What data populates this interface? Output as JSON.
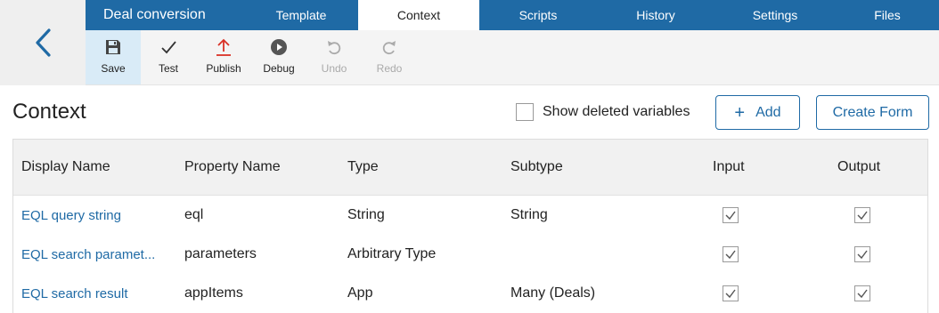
{
  "app": {
    "title": "Deal conversion"
  },
  "tabs": [
    {
      "label": "Template"
    },
    {
      "label": "Context",
      "active": true
    },
    {
      "label": "Scripts"
    },
    {
      "label": "History"
    },
    {
      "label": "Settings"
    },
    {
      "label": "Files"
    }
  ],
  "toolbar": {
    "save": "Save",
    "test": "Test",
    "publish": "Publish",
    "debug": "Debug",
    "undo": "Undo",
    "redo": "Redo"
  },
  "page": {
    "title": "Context",
    "show_deleted_label": "Show deleted variables",
    "show_deleted_checked": false,
    "add_label": "Add",
    "create_form_label": "Create Form"
  },
  "table": {
    "headers": [
      "Display Name",
      "Property Name",
      "Type",
      "Subtype",
      "Input",
      "Output"
    ],
    "rows": [
      {
        "display": "EQL query string",
        "property": "eql",
        "type": "String",
        "subtype": "String",
        "input": true,
        "output": true
      },
      {
        "display": "EQL search paramet...",
        "property": "parameters",
        "type": "Arbitrary Type",
        "subtype": "",
        "input": true,
        "output": true
      },
      {
        "display": "EQL search result",
        "property": "appItems",
        "type": "App",
        "subtype": "Many (Deals)",
        "input": true,
        "output": true
      }
    ]
  },
  "colors": {
    "brand": "#1f6aa5",
    "publish": "#d93025",
    "toolbar_active": "#d9ebf7"
  },
  "icons": {
    "back": "chevron-left-icon",
    "save": "floppy-icon",
    "test": "checkmark-icon",
    "publish": "upload-icon",
    "debug": "play-circle-icon",
    "undo": "undo-icon",
    "redo": "redo-icon"
  }
}
